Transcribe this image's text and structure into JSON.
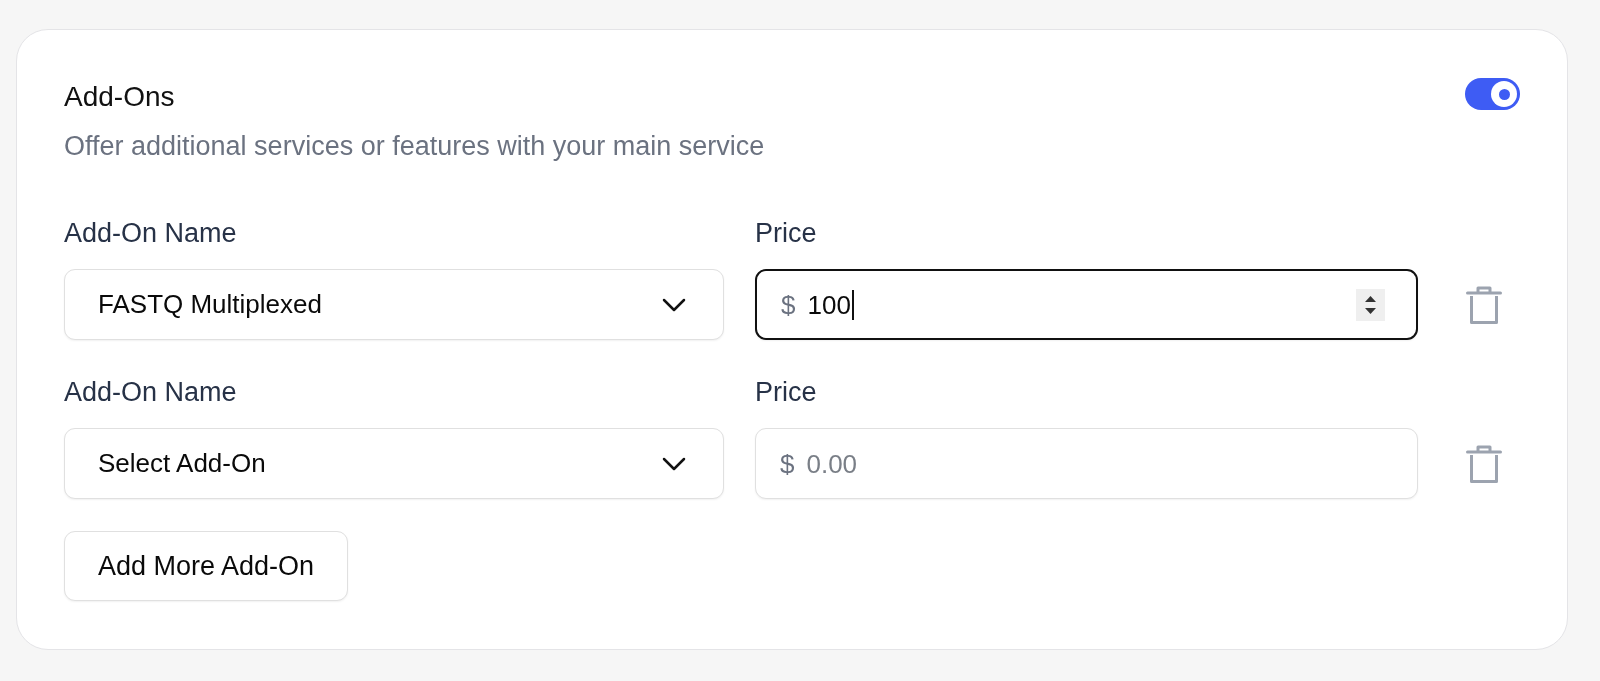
{
  "section": {
    "title": "Add-Ons",
    "description": "Offer additional services or features with your main service",
    "enabled": true
  },
  "add_ons": [
    {
      "name_label": "Add-On Name",
      "name_select": {
        "value": "FASTQ Multiplexed"
      },
      "price_label": "Price",
      "price_field": {
        "currency": "$",
        "value": "100",
        "focused": true
      }
    },
    {
      "name_label": "Add-On Name",
      "name_select": {
        "value": "Select Add-On"
      },
      "price_label": "Price",
      "price_field": {
        "currency": "$",
        "placeholder": "0.00",
        "focused": false
      }
    }
  ],
  "add_button": {
    "label": "Add More Add-On"
  }
}
